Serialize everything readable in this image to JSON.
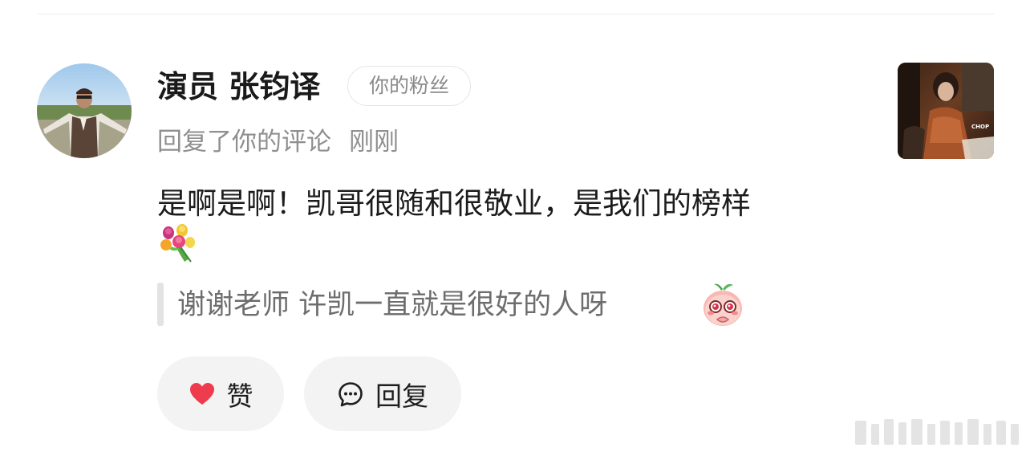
{
  "notification": {
    "username": "演员 张钧译",
    "fan_badge": "你的粉丝",
    "action_text": "回复了你的评论",
    "time": "刚刚",
    "reply_text": "是啊是啊！凯哥很随和很敬业，是我们的榜样",
    "reply_emoji": "bouquet-icon",
    "quoted_comment": "谢谢老师 许凯一直就是很好的人呀",
    "quoted_emoji": "peach-emoji",
    "thumbnail_label": "CHOP"
  },
  "actions": {
    "like_label": "赞",
    "reply_label": "回复"
  },
  "colors": {
    "like_heart": "#ef3b4e",
    "secondary_text": "#8f8f8f",
    "button_bg": "#f3f3f3"
  }
}
